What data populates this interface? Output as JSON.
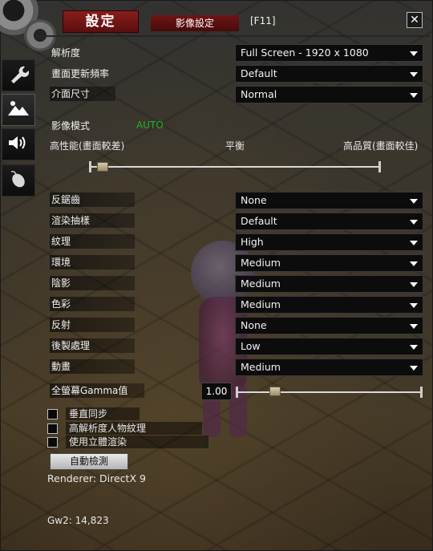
{
  "header": {
    "main_tab": "設定",
    "sub_tab": "影像設定",
    "hotkey": "[F11]",
    "close_glyph": "✕"
  },
  "sidebar": {
    "items": [
      {
        "icon": "wrench-icon",
        "active": false
      },
      {
        "icon": "mountain-image-icon",
        "active": true
      },
      {
        "icon": "speaker-icon",
        "active": false
      },
      {
        "icon": "mouse-icon",
        "active": false
      }
    ]
  },
  "display": {
    "resolution": {
      "label": "解析度",
      "value": "Full Screen - 1920 x 1080"
    },
    "refresh_rate": {
      "label": "畫面更新頻率",
      "value": "Default"
    },
    "interface_size": {
      "label": "介面尺寸",
      "value": "Normal"
    }
  },
  "graphics_mode": {
    "label": "影像模式",
    "auto_tag": "AUTO",
    "left_label": "高性能(畫面較差)",
    "mid_label": "平衡",
    "right_label": "高品質(畫面較佳)",
    "slider_position": 0.03
  },
  "options": [
    {
      "name": "antialiasing",
      "label": "反鋸齒",
      "value": "None"
    },
    {
      "name": "sampling",
      "label": "渲染抽樣",
      "value": "Default"
    },
    {
      "name": "textures",
      "label": "紋理",
      "value": "High"
    },
    {
      "name": "environment",
      "label": "環境",
      "value": "Medium"
    },
    {
      "name": "shadows",
      "label": "陰影",
      "value": "Medium"
    },
    {
      "name": "lighting",
      "label": "色彩",
      "value": "Medium"
    },
    {
      "name": "reflections",
      "label": "反射",
      "value": "None"
    },
    {
      "name": "postprocessing",
      "label": "後製處理",
      "value": "Low"
    },
    {
      "name": "animation",
      "label": "動畫",
      "value": "Medium"
    }
  ],
  "gamma": {
    "label": "全螢幕Gamma值",
    "value": "1.00",
    "slider_position": 0.2
  },
  "checkboxes": [
    {
      "name": "vsync",
      "label": "垂直同步",
      "checked": false
    },
    {
      "name": "high-res-character-textures",
      "label": "高解析度人物紋理",
      "checked": false
    },
    {
      "name": "stereoscopic",
      "label": "使用立體渲染",
      "checked": false
    }
  ],
  "auto_detect_button": "自動檢測",
  "renderer": "Renderer: DirectX 9",
  "gw2_build": "Gw2: 14,823",
  "colors": {
    "tab_red": "#8a1d1d",
    "auto_green": "#1fb024",
    "select_bg": "#0c0c0c"
  }
}
